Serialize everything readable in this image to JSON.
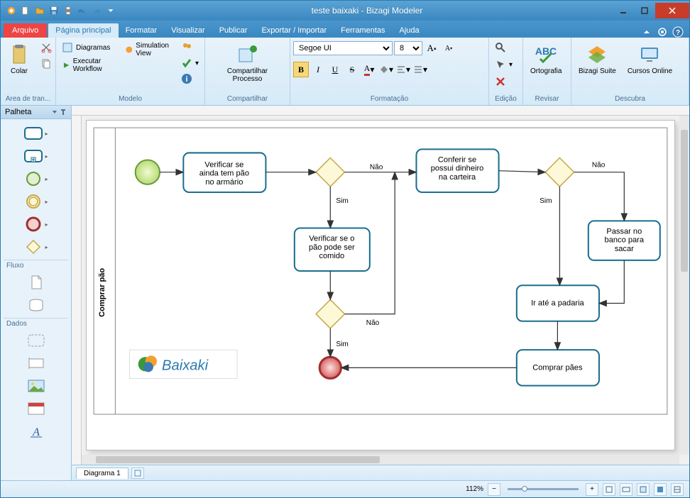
{
  "app": {
    "title": "teste baixaki - Bizagi Modeler"
  },
  "tabs": {
    "file": "Arquivo",
    "items": [
      "Página principal",
      "Formatar",
      "Visualizar",
      "Publicar",
      "Exportar / Importar",
      "Ferramentas",
      "Ajuda"
    ]
  },
  "ribbon": {
    "clipboard": {
      "paste": "Colar",
      "label": "Area de tran..."
    },
    "model": {
      "diagrams": "Diagramas",
      "workflow": "Executar Workflow",
      "simview": "Simulation View",
      "label": "Modelo"
    },
    "share": {
      "share": "Compartilhar Processo",
      "label": "Compartilhar"
    },
    "format": {
      "font": "Segoe UI",
      "size": "8",
      "label": "Formatação"
    },
    "edit": {
      "label": "Edição"
    },
    "review": {
      "spell": "Ortografia",
      "label": "Revisar"
    },
    "discover": {
      "suite": "Bizagi Suite",
      "courses": "Cursos Online",
      "label": "Descubra"
    }
  },
  "palette": {
    "title": "Palheta",
    "cat_flow": "Fluxo",
    "cat_data": "Dados"
  },
  "diagram": {
    "lane": "Comprar pão",
    "tasks": {
      "t1": "Verificar se ainda tem pão no armário",
      "t2": "Conferir se possui dinheiro na carteira",
      "t3": "Verificar se o pão pode ser comido",
      "t4": "Passar no banco para sacar",
      "t5": "Ir até a padaria",
      "t6": "Comprar pães"
    },
    "labels": {
      "yes": "Sim",
      "no": "Não"
    },
    "watermark": "Baixaki",
    "tab": "Diagrama 1"
  },
  "status": {
    "zoom": "112%"
  }
}
